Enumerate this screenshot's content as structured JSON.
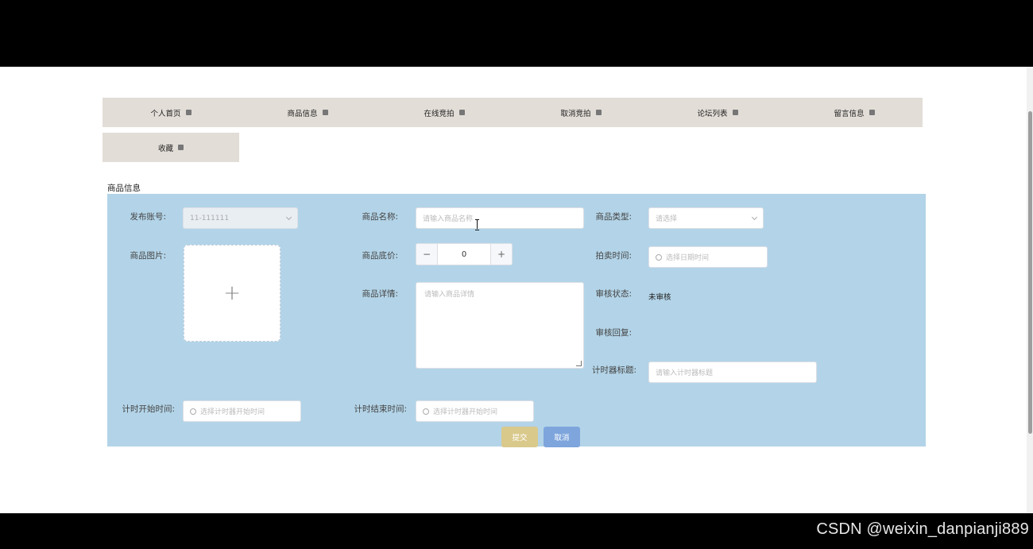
{
  "nav": {
    "items": [
      {
        "label": "个人首页",
        "icon": "home-icon"
      },
      {
        "label": "商品信息",
        "icon": "goods-icon"
      },
      {
        "label": "在线竞拍",
        "icon": "auction-icon"
      },
      {
        "label": "取消竞拍",
        "icon": "cancel-auction-icon"
      },
      {
        "label": "论坛列表",
        "icon": "forum-icon"
      },
      {
        "label": "留言信息",
        "icon": "message-icon"
      }
    ],
    "row2": {
      "label": "收藏",
      "icon": "favorite-icon"
    }
  },
  "section_title": "商品信息",
  "form": {
    "publisher_account_label": "发布账号:",
    "publisher_account_value": "11-111111",
    "product_name_label": "商品名称:",
    "product_name_placeholder": "请输入商品名称",
    "product_type_label": "商品类型:",
    "product_type_placeholder": "请选择",
    "product_image_label": "商品图片:",
    "upload_plus": "+",
    "base_price_label": "商品底价:",
    "base_price_value": "0",
    "stepper_minus": "−",
    "stepper_plus": "+",
    "auction_time_label": "拍卖时间:",
    "auction_time_placeholder": "选择日期时间",
    "product_detail_label": "商品详情:",
    "product_detail_placeholder": "请输入商品详情",
    "review_status_label": "审核状态:",
    "review_status_value": "未审核",
    "review_reply_label": "审核回复:",
    "timer_title_label": "计时器标题:",
    "timer_title_placeholder": "请输入计时器标题",
    "timer_start_label": "计时开始时间:",
    "timer_start_placeholder": "选择计时器开始时间",
    "timer_end_label": "计时结束时间:",
    "timer_end_placeholder": "选择计时器开始时间",
    "submit_label": "提交",
    "cancel_label": "取消"
  },
  "watermark": "CSDN @weixin_danpianji889",
  "colors": {
    "nav_bg": "#e2ddd7",
    "form_bg": "#b3d4e8",
    "submit_bg": "#d9c98b",
    "cancel_bg": "#7ea5dc"
  }
}
